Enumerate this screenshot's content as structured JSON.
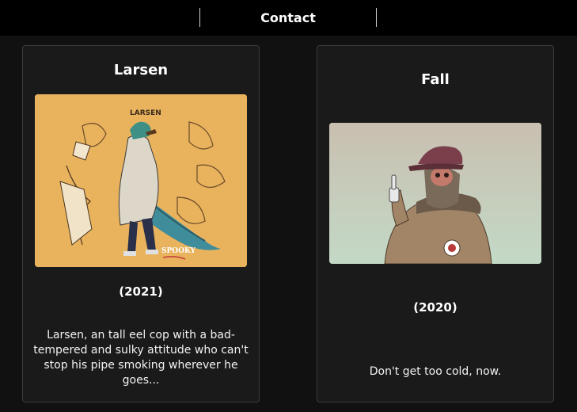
{
  "nav": {
    "contact_label": "Contact"
  },
  "cards": [
    {
      "title": "Larsen",
      "year": "(2021)",
      "description": "Larsen, an tall eel cop with a bad-tempered and sulky attitude who can't stop his pipe smoking wherever he goes...",
      "art_caption": "LARSEN",
      "art_signature": "SPOOKY",
      "art_background": "#e8b25c"
    },
    {
      "title": "Fall",
      "year": "(2020)",
      "description": "Don't get too cold, now.",
      "art_background": "#c9d8c4"
    }
  ],
  "colors": {
    "page_bg": "#111111",
    "card_bg": "#1a1a1a",
    "topbar_bg": "#000000",
    "card_border": "#3c3c3c"
  }
}
